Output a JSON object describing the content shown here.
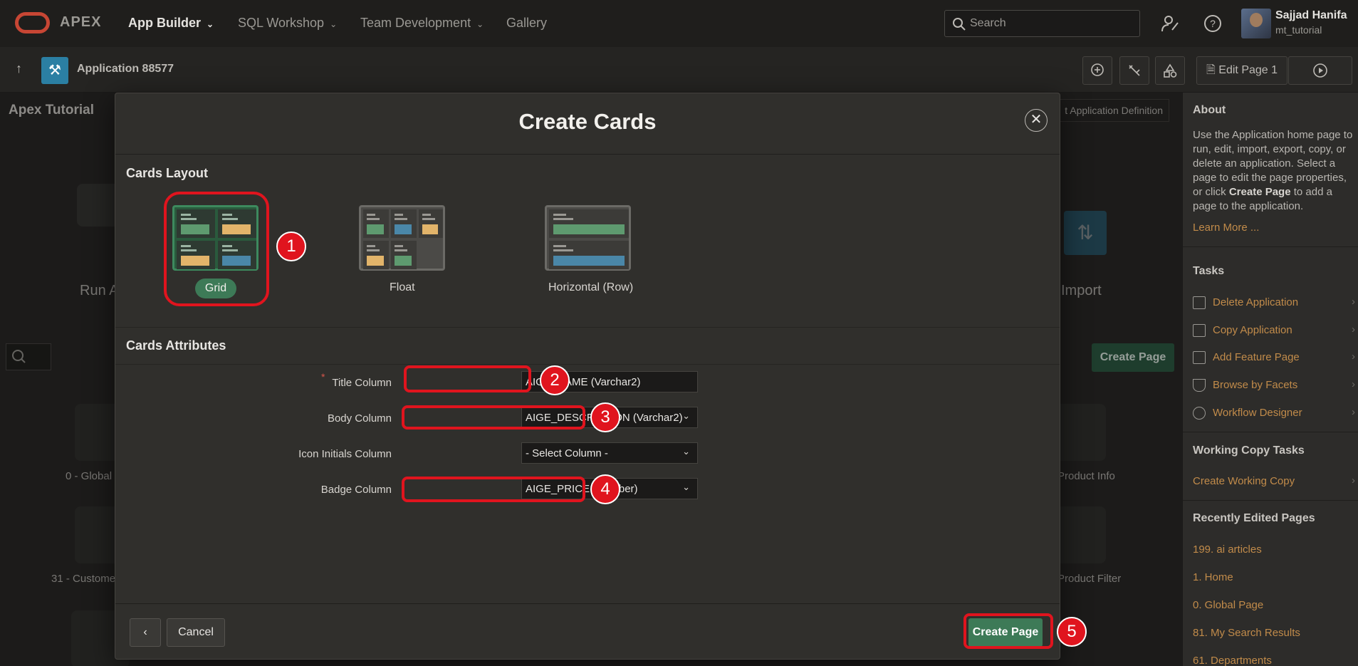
{
  "topnav": {
    "brand": "APEX",
    "items": [
      {
        "label": "App Builder",
        "caret": true,
        "active": true
      },
      {
        "label": "SQL Workshop",
        "caret": true,
        "active": false
      },
      {
        "label": "Team Development",
        "caret": true,
        "active": false
      },
      {
        "label": "Gallery",
        "caret": false,
        "active": false
      }
    ],
    "search_placeholder": "Search",
    "user_name": "Sajjad Hanifa",
    "user_id": "mt_tutorial"
  },
  "subbar": {
    "app_title": "Application 88577",
    "edit_page_label": "Edit Page 1"
  },
  "background": {
    "page_title": "Apex Tutorial",
    "app_def_btn": "t Application Definition",
    "run_label": "Run A",
    "import_label": "Import",
    "create_page_btn": "Create Page",
    "tiles": [
      "0 - Global",
      "31 - Custome",
      "Product Info",
      "Product Filter"
    ]
  },
  "sidebar": {
    "about_title": "About",
    "about_text_1": "Use the Application home page to run, edit, import, export, copy, or delete an application. Select a page to edit the page properties, or click ",
    "about_text_bold": "Create Page",
    "about_text_2": " to add a page to the application.",
    "learn_more": "Learn More ...",
    "tasks_title": "Tasks",
    "tasks": [
      {
        "label": "Delete Application",
        "icon": "trash-icon"
      },
      {
        "label": "Copy Application",
        "icon": "copy-icon"
      },
      {
        "label": "Add Feature Page",
        "icon": "page-add-icon"
      },
      {
        "label": "Browse by Facets",
        "icon": "funnel-icon"
      },
      {
        "label": "Workflow Designer",
        "icon": "workflow-icon"
      }
    ],
    "working_copy_title": "Working Copy Tasks",
    "working_copy_link": "Create Working Copy",
    "recent_title": "Recently Edited Pages",
    "recent": [
      "199. ai articles",
      "1. Home",
      "0. Global Page",
      "81. My Search Results",
      "61. Departments"
    ]
  },
  "dialog": {
    "title": "Create Cards",
    "layout_section": "Cards Layout",
    "layouts": [
      {
        "label": "Grid",
        "selected": true
      },
      {
        "label": "Float",
        "selected": false
      },
      {
        "label": "Horizontal (Row)",
        "selected": false
      }
    ],
    "attributes_section": "Cards Attributes",
    "fields": [
      {
        "label": "Title Column",
        "value": "AIGE_NAME (Varchar2)",
        "required": true
      },
      {
        "label": "Body Column",
        "value": "AIGE_DESCRIPTION (Varchar2)",
        "required": false
      },
      {
        "label": "Icon Initials Column",
        "value": "- Select Column -",
        "required": false
      },
      {
        "label": "Badge Column",
        "value": "AIGE_PRICE (Number)",
        "required": false
      }
    ],
    "cancel_label": "Cancel",
    "create_label": "Create Page"
  },
  "annotations": [
    "1",
    "2",
    "3",
    "4",
    "5"
  ],
  "colors": {
    "accent_green": "#3d7a57",
    "annotation_red": "#e0141e",
    "link_orange": "#c18b4a",
    "brand_red": "#c74634"
  }
}
